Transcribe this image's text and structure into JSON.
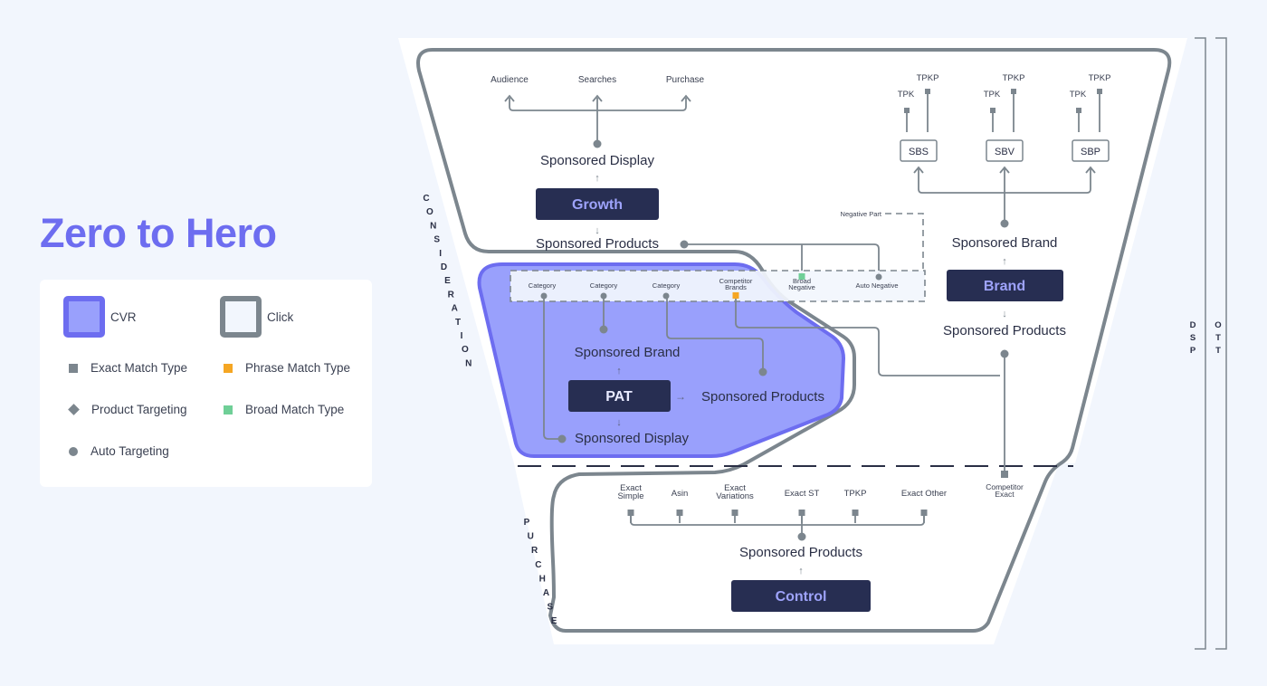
{
  "title": "Zero to Hero",
  "legend": {
    "cvr": "CVR",
    "click": "Click",
    "exact": "Exact Match Type",
    "phrase": "Phrase Match Type",
    "product": "Product Targeting",
    "broad": "Broad Match Type",
    "auto": "Auto Targeting",
    "colors": {
      "cvr_fill": "#99a0fc",
      "cvr_border": "#6d6df0",
      "click_border": "#7c868e",
      "exact": "#7c868e",
      "phrase": "#f5a623",
      "broad": "#6fcf97"
    }
  },
  "stages": {
    "consideration": "CONSIDERATION",
    "purchase": "PURCHASE",
    "dsp": "DSP",
    "ott": "OTT"
  },
  "growth": {
    "label": "Growth",
    "top": "Sponsored Display",
    "bottom": "Sponsored Products",
    "targets": [
      "Audience",
      "Searches",
      "Purchase"
    ]
  },
  "brand": {
    "label": "Brand",
    "top": "Sponsored Brand",
    "bottom": "Sponsored Products",
    "formats": [
      {
        "name": "SBS",
        "tpk": "TPK",
        "tpkp": "TPKP"
      },
      {
        "name": "SBV",
        "tpk": "TPK",
        "tpkp": "TPKP"
      },
      {
        "name": "SBP",
        "tpk": "TPK",
        "tpkp": "TPKP"
      }
    ]
  },
  "negative": {
    "label": "Negative Part",
    "items": [
      "Category",
      "Category",
      "Category",
      "Competitor Brands",
      "Broad Negative",
      "Auto Negative"
    ]
  },
  "pat": {
    "label": "PAT",
    "top": "Sponsored Brand",
    "right": "Sponsored Products",
    "bottom": "Sponsored Display"
  },
  "control": {
    "label": "Control",
    "top": "Sponsored Products",
    "targets": [
      "Exact Simple",
      "Asin",
      "Exact Variations",
      "Exact ST",
      "TPKP",
      "Exact Other"
    ],
    "competitor": "Competitor Exact"
  }
}
